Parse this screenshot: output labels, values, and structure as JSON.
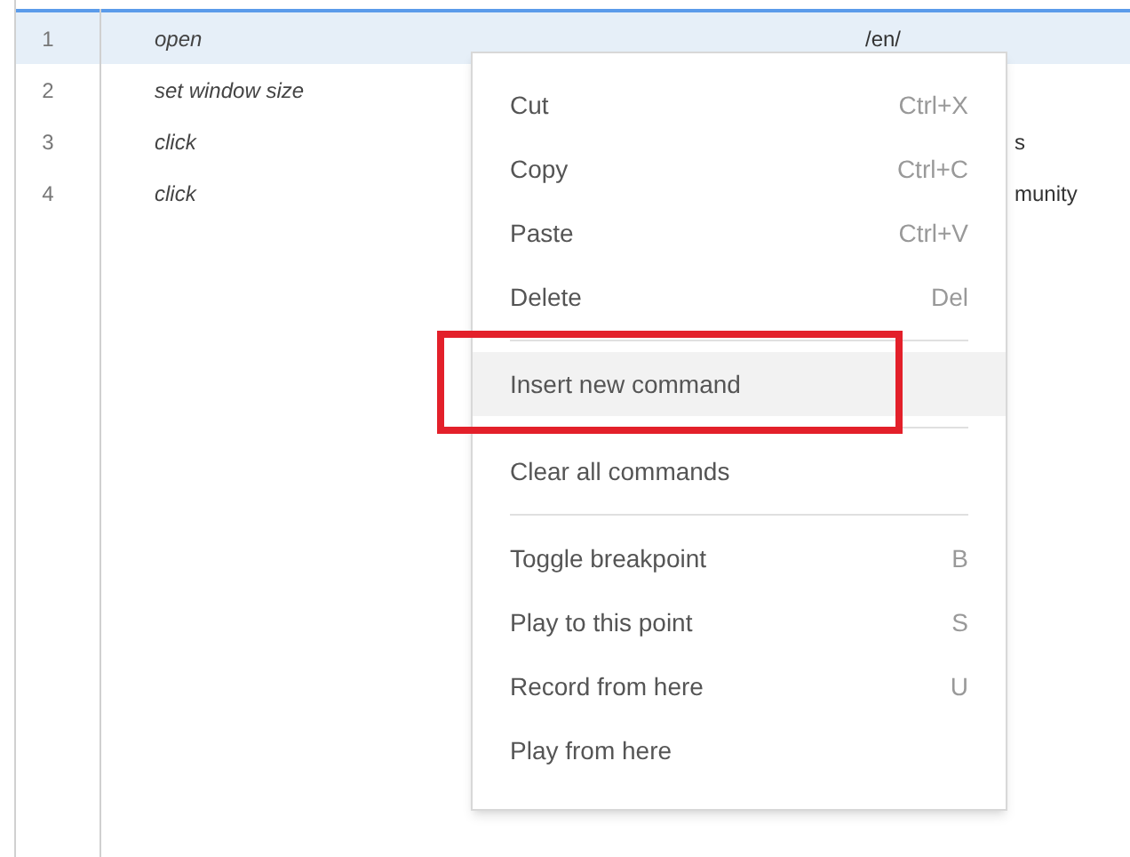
{
  "rows": [
    {
      "number": "1",
      "command": "open",
      "target": "/en/",
      "selected": true
    },
    {
      "number": "2",
      "command": "set window size",
      "target": "",
      "selected": false
    },
    {
      "number": "3",
      "command": "click",
      "target": "s",
      "selected": false
    },
    {
      "number": "4",
      "command": "click",
      "target": "munity",
      "selected": false
    }
  ],
  "context_menu": {
    "groups": [
      [
        {
          "label": "Cut",
          "shortcut": "Ctrl+X",
          "highlighted": false
        },
        {
          "label": "Copy",
          "shortcut": "Ctrl+C",
          "highlighted": false
        },
        {
          "label": "Paste",
          "shortcut": "Ctrl+V",
          "highlighted": false
        },
        {
          "label": "Delete",
          "shortcut": "Del",
          "highlighted": false
        }
      ],
      [
        {
          "label": "Insert new command",
          "highlighted": true
        }
      ],
      [
        {
          "label": "Clear all commands",
          "highlighted": false
        }
      ],
      [
        {
          "label": "Toggle breakpoint",
          "shortcut": "B",
          "highlighted": false
        },
        {
          "label": "Play to this point",
          "shortcut": "S",
          "highlighted": false
        },
        {
          "label": "Record from here",
          "shortcut": "U",
          "highlighted": false
        },
        {
          "label": "Play from here",
          "highlighted": false
        }
      ]
    ]
  }
}
